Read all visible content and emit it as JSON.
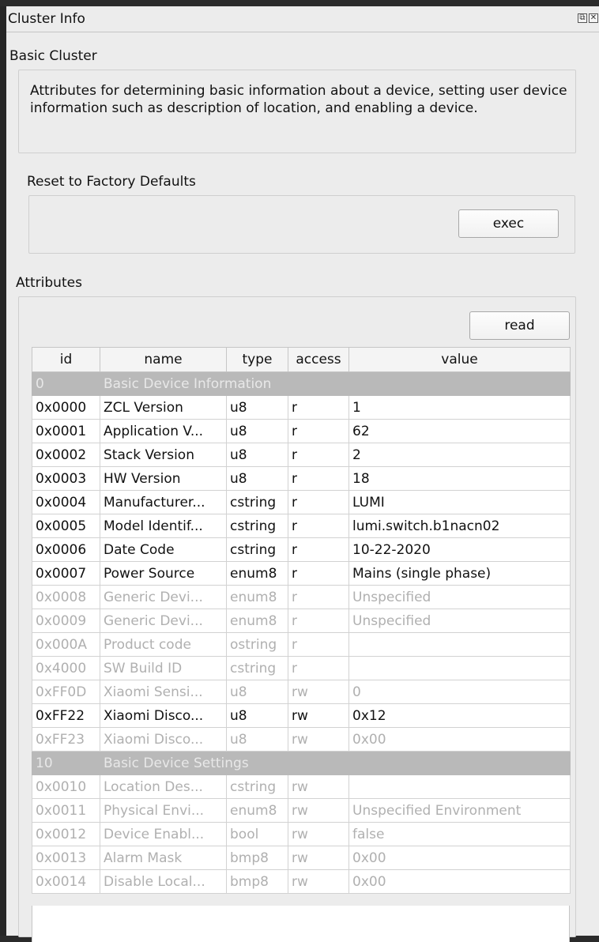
{
  "window": {
    "title": "Cluster Info"
  },
  "basic_cluster": {
    "title": "Basic Cluster",
    "description": "Attributes for determining basic information about a device, setting user device information such as description of location, and enabling a device."
  },
  "reset": {
    "title": "Reset to Factory Defaults",
    "exec_label": "exec"
  },
  "attributes": {
    "title": "Attributes",
    "read_label": "read",
    "columns": [
      "id",
      "name",
      "type",
      "access",
      "value"
    ],
    "rows": [
      {
        "kind": "section",
        "id": "0",
        "name": "Basic Device Information",
        "type": "",
        "access": "",
        "value": ""
      },
      {
        "kind": "active",
        "id": "0x0000",
        "name": "ZCL Version",
        "type": "u8",
        "access": "r",
        "value": "1"
      },
      {
        "kind": "active",
        "id": "0x0001",
        "name": "Application V...",
        "type": "u8",
        "access": "r",
        "value": "62"
      },
      {
        "kind": "active",
        "id": "0x0002",
        "name": "Stack Version",
        "type": "u8",
        "access": "r",
        "value": "2"
      },
      {
        "kind": "active",
        "id": "0x0003",
        "name": "HW Version",
        "type": "u8",
        "access": "r",
        "value": "18"
      },
      {
        "kind": "active",
        "id": "0x0004",
        "name": "Manufacturer...",
        "type": "cstring",
        "access": "r",
        "value": "LUMI"
      },
      {
        "kind": "active",
        "id": "0x0005",
        "name": "Model Identif...",
        "type": "cstring",
        "access": "r",
        "value": "lumi.switch.b1nacn02"
      },
      {
        "kind": "active",
        "id": "0x0006",
        "name": "Date Code",
        "type": "cstring",
        "access": "r",
        "value": "10-22-2020"
      },
      {
        "kind": "active",
        "id": "0x0007",
        "name": "Power Source",
        "type": "enum8",
        "access": "r",
        "value": "Mains (single phase)"
      },
      {
        "kind": "dim",
        "id": "0x0008",
        "name": "Generic Devi...",
        "type": "enum8",
        "access": "r",
        "value": "Unspecified"
      },
      {
        "kind": "dim",
        "id": "0x0009",
        "name": "Generic Devi...",
        "type": "enum8",
        "access": "r",
        "value": "Unspecified"
      },
      {
        "kind": "dim",
        "id": "0x000A",
        "name": "Product code",
        "type": "ostring",
        "access": "r",
        "value": ""
      },
      {
        "kind": "dim",
        "id": "0x4000",
        "name": "SW Build ID",
        "type": "cstring",
        "access": "r",
        "value": ""
      },
      {
        "kind": "dim",
        "id": "0xFF0D",
        "name": "Xiaomi Sensi...",
        "type": "u8",
        "access": "rw",
        "value": "0"
      },
      {
        "kind": "active",
        "id": "0xFF22",
        "name": "Xiaomi Disco...",
        "type": "u8",
        "access": "rw",
        "value": "0x12"
      },
      {
        "kind": "dim",
        "id": "0xFF23",
        "name": "Xiaomi Disco...",
        "type": "u8",
        "access": "rw",
        "value": "0x00"
      },
      {
        "kind": "section",
        "id": "10",
        "name": "Basic Device Settings",
        "type": "",
        "access": "",
        "value": ""
      },
      {
        "kind": "dim",
        "id": "0x0010",
        "name": "Location Des...",
        "type": "cstring",
        "access": "rw",
        "value": ""
      },
      {
        "kind": "dim",
        "id": "0x0011",
        "name": "Physical Envi...",
        "type": "enum8",
        "access": "rw",
        "value": "Unspecified Environment"
      },
      {
        "kind": "dim",
        "id": "0x0012",
        "name": "Device Enabl...",
        "type": "bool",
        "access": "rw",
        "value": "false"
      },
      {
        "kind": "dim",
        "id": "0x0013",
        "name": "Alarm Mask",
        "type": "bmp8",
        "access": "rw",
        "value": "0x00"
      },
      {
        "kind": "dim",
        "id": "0x0014",
        "name": "Disable Local...",
        "type": "bmp8",
        "access": "rw",
        "value": "0x00"
      }
    ]
  }
}
